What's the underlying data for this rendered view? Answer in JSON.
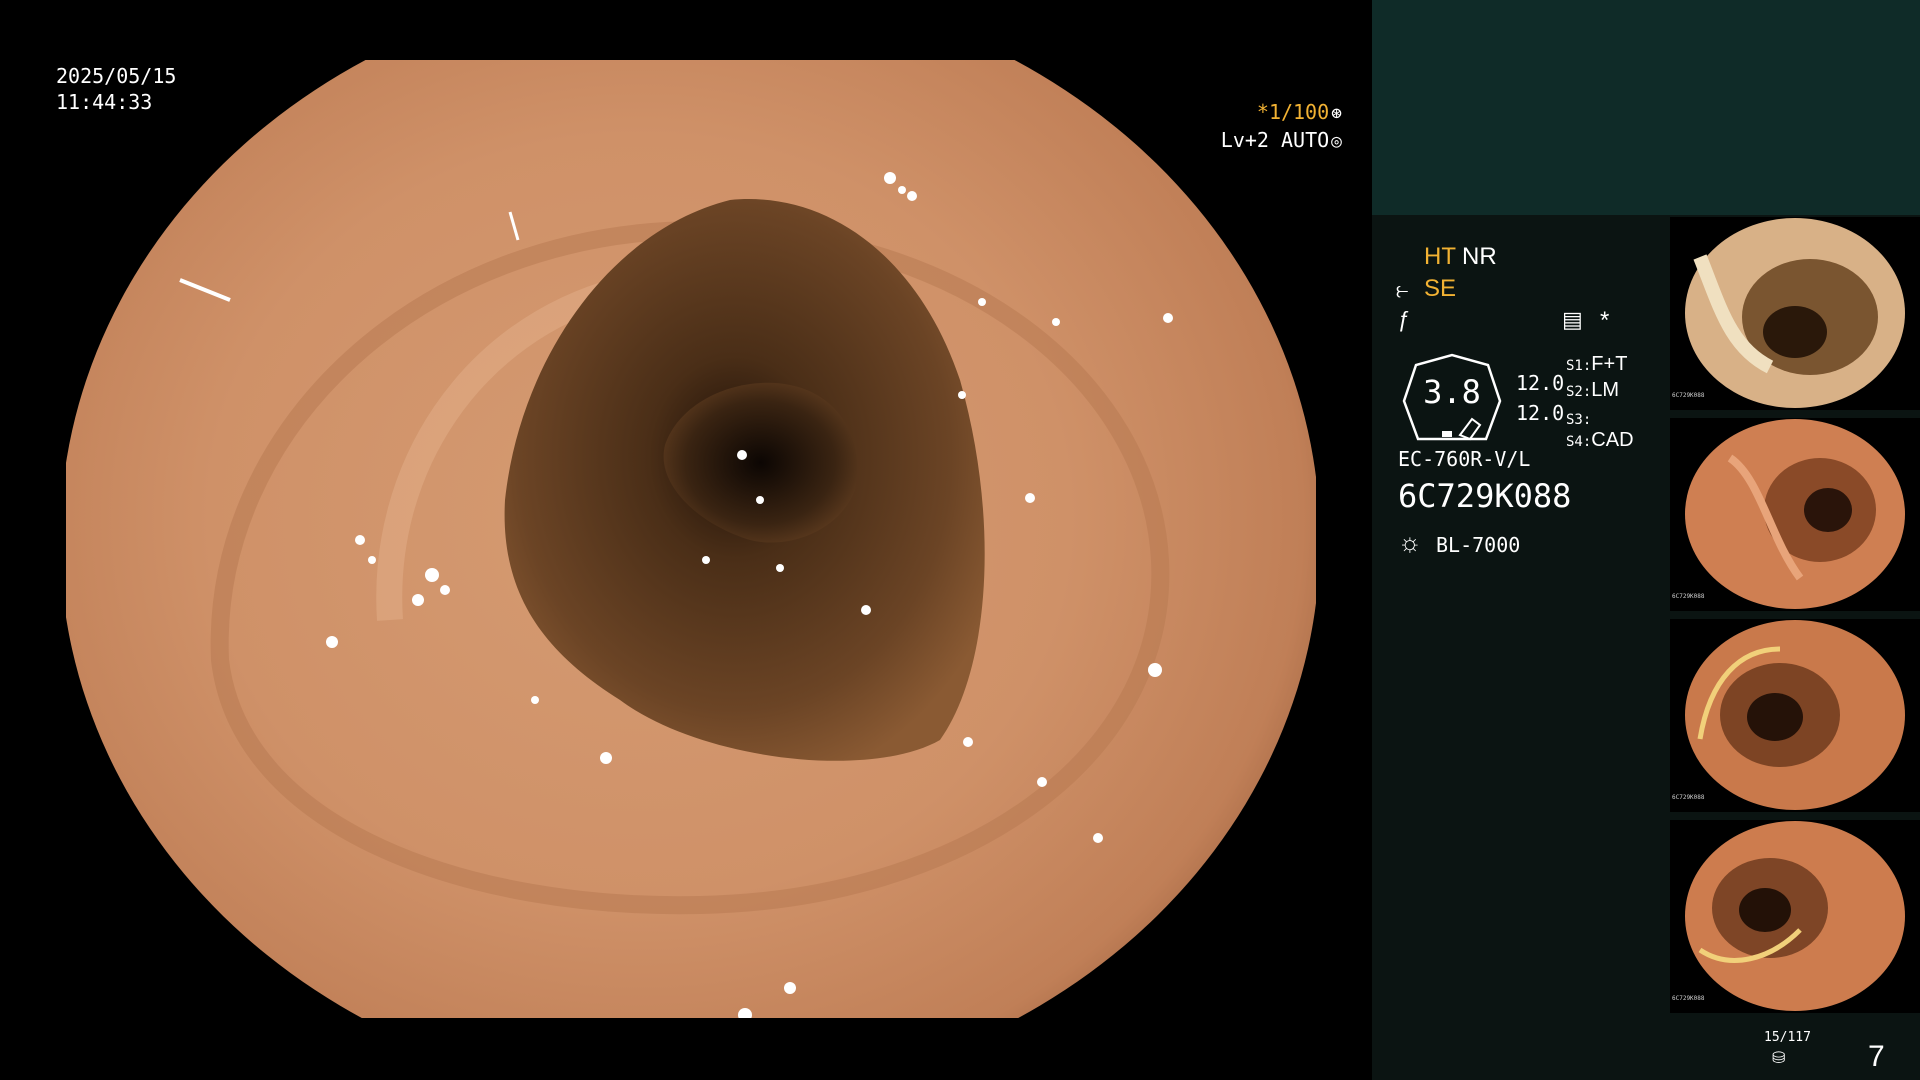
{
  "osd": {
    "date": "2025/05/15",
    "time": "11:44:33",
    "magnification_prefix": "*",
    "magnification": "1/100",
    "magnification_icon": "aperture-icon",
    "level": "Lv+2 AUTO",
    "level_icon": "auto-iris-icon"
  },
  "panel": {
    "mode_ht": "HT",
    "mode_nr": "NR",
    "mode_se": "SE",
    "mode_se_icon": "structure-enhance-icon",
    "mode_f_icon": "color-enhance-icon",
    "doc_icon": "record-icon",
    "star": "*",
    "gauge_value": "3.8",
    "value_a": "12.0",
    "value_b": "12.0",
    "switches": [
      {
        "label": "S1:",
        "value": "F+T"
      },
      {
        "label": "S2:",
        "value": "LM"
      },
      {
        "label": "S3:",
        "value": ""
      },
      {
        "label": "S4:",
        "value": "CAD"
      }
    ],
    "scope_model": "EC-760R-V/L",
    "scope_serial": "6C729K088",
    "light_icon": "light-source-icon",
    "light_source": "BL-7000"
  },
  "thumbnails": [
    {
      "caption": "6C729K088"
    },
    {
      "caption": "6C729K088"
    },
    {
      "caption": "6C729K088"
    },
    {
      "caption": "6C729K088"
    }
  ],
  "counter": {
    "fraction": "15/117",
    "icon": "storage-icon",
    "page": "7"
  },
  "colors": {
    "accent_amber": "#f2b233",
    "panel_top": "#0f2b28",
    "panel_bg": "#0b1412",
    "mucosa": "#c98a62",
    "lumen": "#3d2614"
  }
}
